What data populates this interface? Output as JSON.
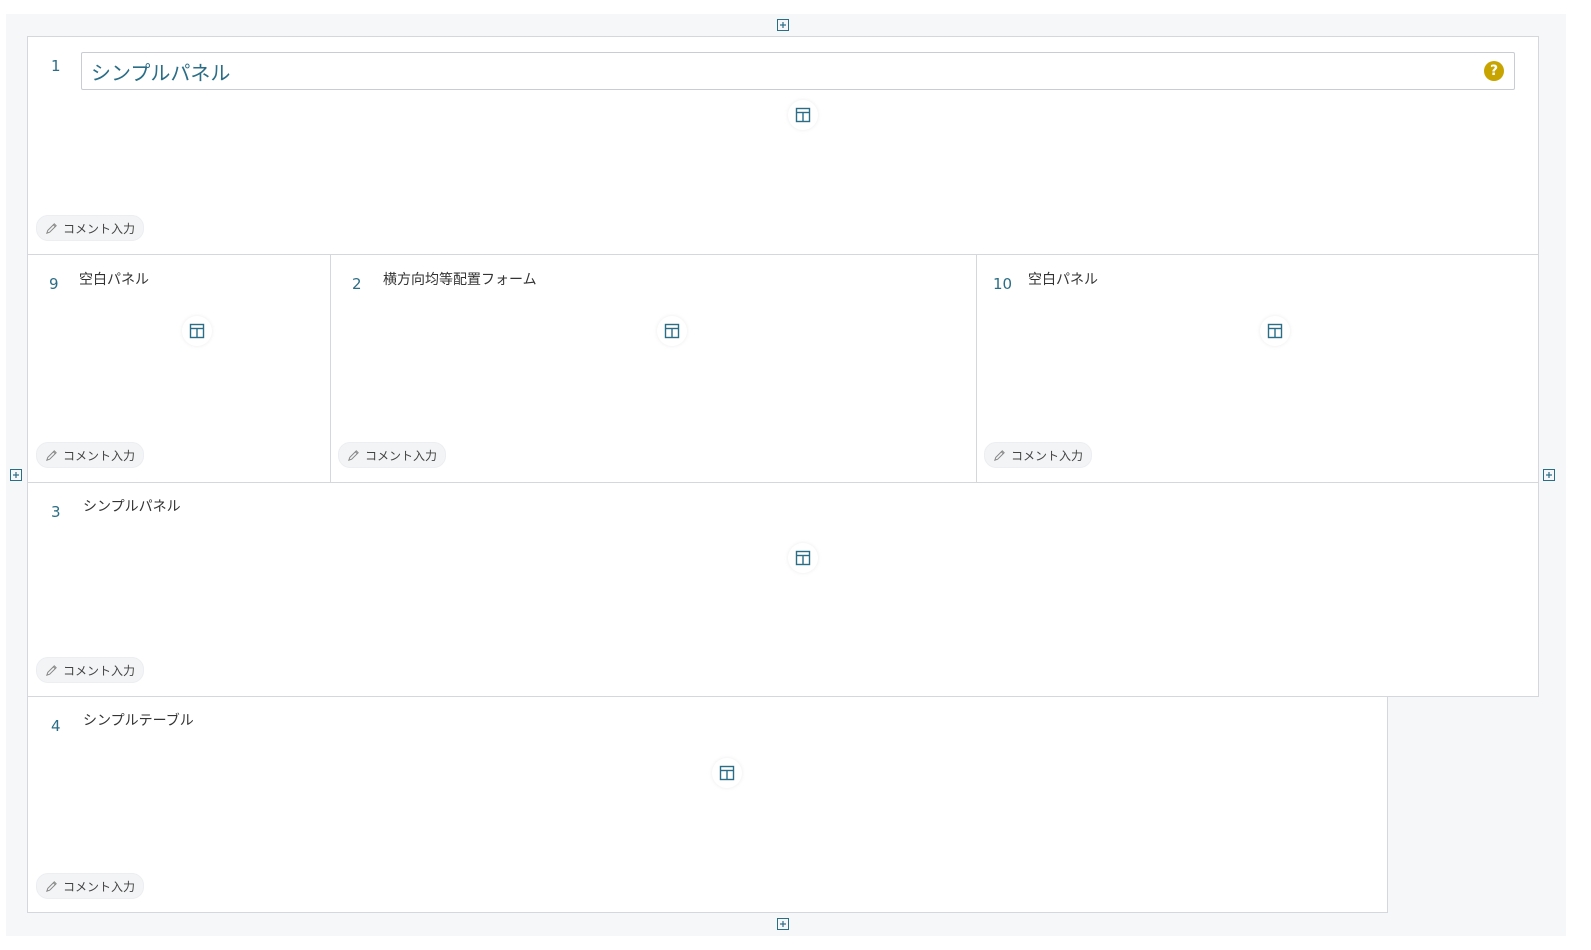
{
  "colors": {
    "accent": "#2b6d86",
    "help_badge": "#c7a400",
    "border": "#d4d7dc",
    "background": "#f6f7f9"
  },
  "icons": {
    "layout": "layout-icon",
    "comment": "pencil-icon",
    "add": "plus-square-icon",
    "help": "help-icon"
  },
  "panels": {
    "p1": {
      "number": "1",
      "title_input_value": "シンプルパネル",
      "help_symbol": "?",
      "comment_label": "コメント入力"
    },
    "p9": {
      "number": "9",
      "title": "空白パネル",
      "comment_label": "コメント入力"
    },
    "p2": {
      "number": "2",
      "title": "横方向均等配置フォーム",
      "comment_label": "コメント入力"
    },
    "p10": {
      "number": "10",
      "title": "空白パネル",
      "comment_label": "コメント入力"
    },
    "p3": {
      "number": "3",
      "title": "シンプルパネル",
      "comment_label": "コメント入力"
    },
    "p4": {
      "number": "4",
      "title": "シンプルテーブル",
      "comment_label": "コメント入力"
    }
  }
}
